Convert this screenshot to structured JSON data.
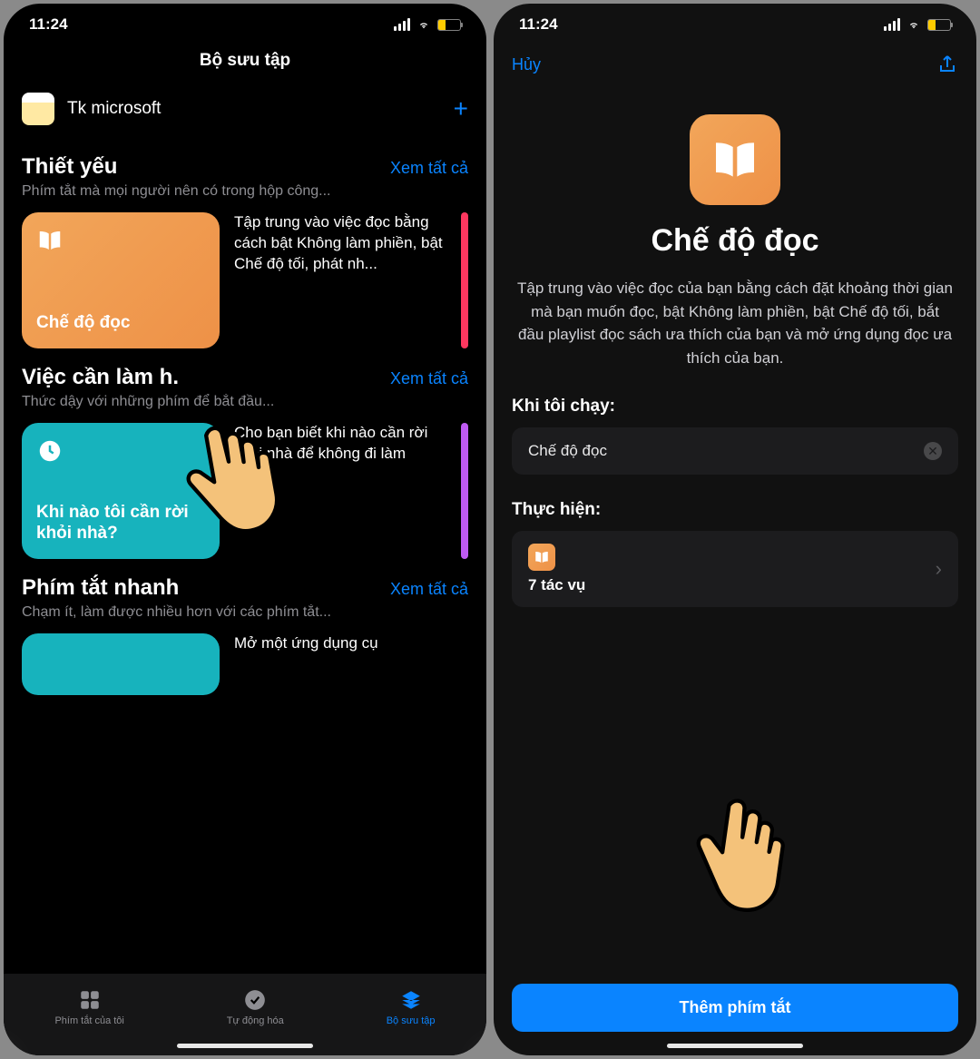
{
  "status": {
    "time": "11:24"
  },
  "left": {
    "title": "Bộ sưu tập",
    "folder": "Tk microsoft",
    "sections": [
      {
        "title": "Thiết yếu",
        "see_all": "Xem tất cả",
        "subtitle": "Phím tắt mà mọi người nên có trong hộp công...",
        "card_title": "Chế độ đọc",
        "card_desc": "Tập trung vào việc đọc bằng cách bật Không làm phiền, bật Chế độ tối, phát nh..."
      },
      {
        "title": "Việc cần làm h.",
        "see_all": "Xem tất cả",
        "subtitle": "Thức dậy với những phím          để bắt đầu...",
        "card_title": "Khi nào tôi cần rời khỏi nhà?",
        "card_desc": "Cho bạn biết khi nào cần rời khỏi nhà để không đi làm muộn"
      },
      {
        "title": "Phím tắt nhanh",
        "see_all": "Xem tất cả",
        "subtitle": "Chạm ít, làm được nhiều hơn với các phím tắt...",
        "card_desc": "Mở một ứng dụng cụ"
      }
    ],
    "tabs": {
      "my": "Phím tắt của tôi",
      "auto": "Tự động hóa",
      "gallery": "Bộ sưu tập"
    }
  },
  "right": {
    "cancel": "Hủy",
    "title": "Chế độ đọc",
    "desc": "Tập trung vào việc đọc của bạn bằng cách đặt khoảng thời gian mà bạn muốn đọc, bật Không làm phiền, bật Chế độ tối, bắt đầu playlist đọc sách ưa thích của bạn và mở ứng dụng đọc ưa thích của bạn.",
    "run_label": "Khi tôi chạy:",
    "run_value": "Chế độ đọc",
    "do_label": "Thực hiện:",
    "tasks": "7 tác vụ",
    "add_button": "Thêm phím tắt"
  }
}
